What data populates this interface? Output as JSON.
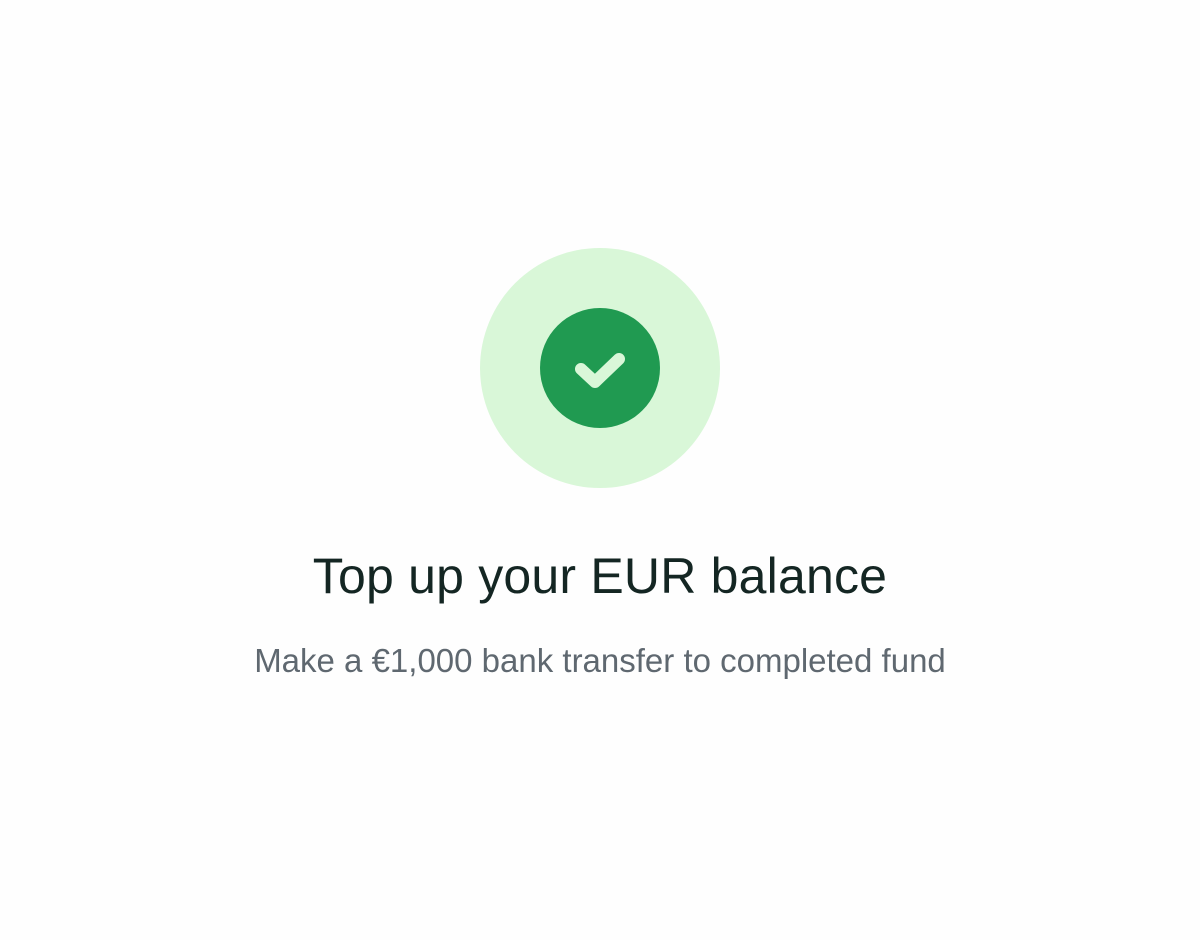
{
  "status": {
    "icon": "check-icon",
    "colors": {
      "halo": "#D9F7D8",
      "badge": "#209A51",
      "check": "#D9F7D8"
    }
  },
  "task": {
    "title": "Top up your EUR balance",
    "description": "Make a €1,000 bank transfer to completed fund"
  }
}
